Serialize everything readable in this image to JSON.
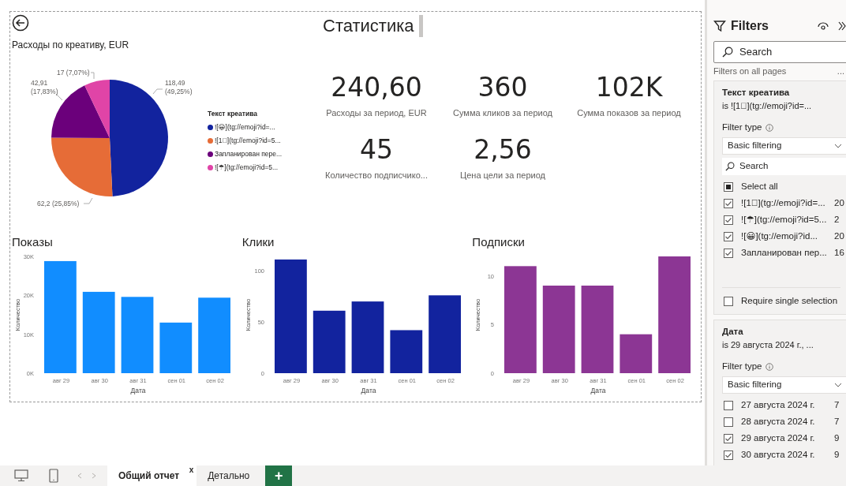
{
  "report": {
    "title": "Статистика",
    "pie": {
      "title": "Расходы по креативу, EUR",
      "legend_title": "Текст креатива",
      "chart_data": {
        "type": "pie",
        "categories": [
          "![😀](tg://emoji?id=...",
          "![1⃞](tg://emoji?id=5...",
          "Запланирован пере...",
          "![☂](tg://emoji?id=5..."
        ],
        "series": [
          {
            "values": [
              49.25,
              25.85,
              17.83,
              7.07
            ]
          }
        ],
        "colors": [
          "#12239e",
          "#e66c37",
          "#6b007b",
          "#e044a7"
        ],
        "value_labels": [
          "118,49 (49,25%)",
          "62,2 (25,85%)",
          "42,91 (17,83%)",
          "17 (7,07%)"
        ]
      }
    },
    "kpis": [
      {
        "value": "240,60",
        "label": "Расходы за период, EUR"
      },
      {
        "value": "360",
        "label": "Сумма кликов за период"
      },
      {
        "value": "102K",
        "label": "Сумма показов за период"
      },
      {
        "value": "45",
        "label": "Количество подписчико..."
      },
      {
        "value": "2,56",
        "label": "Цена цели за период"
      }
    ],
    "bar_charts": [
      {
        "chart_data": {
          "type": "bar",
          "title": "Показы",
          "xlabel": "Дата",
          "ylabel": "Количество",
          "categories": [
            "авг 29",
            "авг 30",
            "авг 31",
            "сен 01",
            "сен 02"
          ],
          "series": [
            {
              "color": "#118dff",
              "values": [
                28800,
                20900,
                19600,
                13000,
                19400
              ]
            }
          ],
          "ylim": [
            0,
            30000
          ],
          "yticks": [
            {
              "value": 0,
              "label": "0K"
            },
            {
              "value": 10000,
              "label": "10K"
            },
            {
              "value": 20000,
              "label": "20K"
            },
            {
              "value": 30000,
              "label": "30K"
            }
          ]
        }
      },
      {
        "chart_data": {
          "type": "bar",
          "title": "Клики",
          "xlabel": "Дата",
          "ylabel": "Количество",
          "categories": [
            "авг 29",
            "авг 30",
            "авг 31",
            "сен 01",
            "сен 02"
          ],
          "series": [
            {
              "color": "#12239e",
              "values": [
                111,
                61,
                70,
                42,
                76
              ]
            }
          ],
          "ylim": [
            0,
            114
          ],
          "yticks": [
            0,
            50,
            100
          ]
        }
      },
      {
        "chart_data": {
          "type": "bar",
          "title": "Подписки",
          "xlabel": "Дата",
          "ylabel": "Количество",
          "categories": [
            "авг 29",
            "авг 30",
            "авг 31",
            "сен 01",
            "сен 02"
          ],
          "series": [
            {
              "color": "#8c3694",
              "values": [
                11,
                9,
                9,
                4,
                12
              ]
            }
          ],
          "ylim": [
            0,
            12
          ],
          "yticks": [
            0,
            5,
            10
          ]
        }
      }
    ]
  },
  "filters": {
    "title": "Filters",
    "search": {
      "placeholder": "Search"
    },
    "section_label": "Filters on all pages",
    "more": "...",
    "cards": [
      {
        "title": "Текст креатива",
        "summary": "is ![1⃞](tg://emoji?id=...",
        "filter_type_label": "Filter type",
        "filter_type": "Basic filtering",
        "search": {
          "placeholder": "Search"
        },
        "select_all": {
          "label": "Select all",
          "indeterminate": true
        },
        "items": [
          {
            "label": "![1⃞](tg://emoji?id=...",
            "count": "20",
            "checked": true
          },
          {
            "label": "![☂](tg://emoji?id=5...",
            "count": "2",
            "checked": true
          },
          {
            "label": "![😀](tg://emoji?id...",
            "count": "20",
            "checked": true
          },
          {
            "label": "Запланирован пер...",
            "count": "16",
            "checked": true
          }
        ],
        "require_single": {
          "label": "Require single selection",
          "checked": false
        }
      },
      {
        "title": "Дата",
        "summary": "is 29 августа 2024 г., ...",
        "filter_type_label": "Filter type",
        "filter_type": "Basic filtering",
        "items": [
          {
            "label": "27 августа 2024 г.",
            "count": "7",
            "checked": false
          },
          {
            "label": "28 августа 2024 г.",
            "count": "7",
            "checked": false
          },
          {
            "label": "29 августа 2024 г.",
            "count": "9",
            "checked": true
          },
          {
            "label": "30 августа 2024 г.",
            "count": "9",
            "checked": true
          }
        ]
      }
    ]
  },
  "page_tabs": {
    "tabs": [
      {
        "label": "Общий отчет",
        "selected": true,
        "close": "x"
      },
      {
        "label": "Детально",
        "selected": false
      }
    ],
    "add": "+"
  }
}
